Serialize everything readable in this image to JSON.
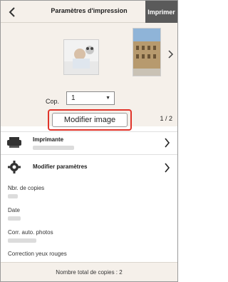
{
  "header": {
    "title": "Paramètres d'impression",
    "print_label": "Imprimer"
  },
  "preview": {
    "copies_label": "Cop.",
    "copies_value": "1",
    "modify_label": "Modifier image",
    "page_indicator": "1 / 2"
  },
  "settings": [
    {
      "label": "Imprimante",
      "icon": "printer-icon"
    },
    {
      "label": "Modifier paramètres",
      "icon": "gear-icon"
    }
  ],
  "info": {
    "copies_label": "Nbr. de copies",
    "date_label": "Date",
    "auto_correct_label": "Corr. auto. photos",
    "redeye_label": "Correction yeux rouges"
  },
  "footer": {
    "total_label": "Nombre total de copies : 2"
  },
  "colors": {
    "background": "#f5f0ea",
    "print_button": "#5a5a5a",
    "highlight_border": "#e0342a"
  }
}
